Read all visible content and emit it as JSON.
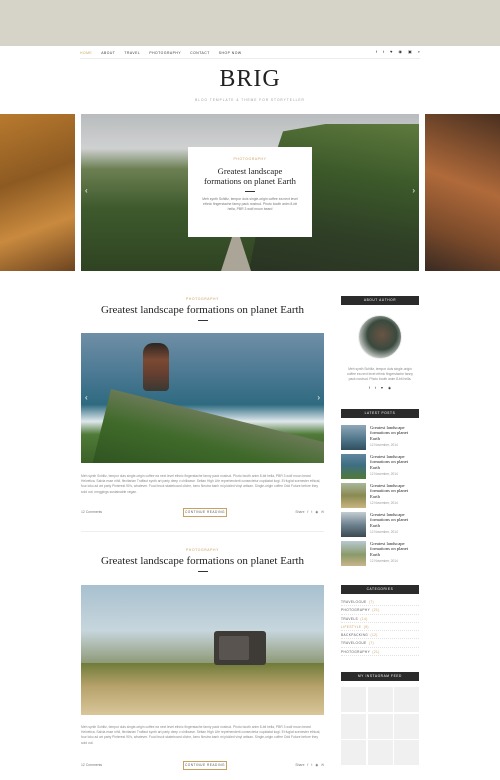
{
  "nav": {
    "items": [
      "Home",
      "About",
      "Travel",
      "Photography",
      "Contact",
      "Shop Now"
    ],
    "socials": [
      "f",
      "t",
      "♥",
      "◉",
      "▣",
      "⌕"
    ]
  },
  "header": {
    "logo": "BRIG",
    "tagline": "Blog Template & Theme for Storyteller"
  },
  "slider": {
    "category": "Photography",
    "title": "Greatest landscape formations on planet Earth",
    "text": "Meh synth Schlitz, tempor duis single-origin coffee ea next level ethnic fingerstache fanny pack nostrud. Photo booth anim 8-bit hella, PBR 3 wolf moon beard",
    "prev": "‹",
    "next": "›"
  },
  "posts": [
    {
      "category": "Photography",
      "title": "Greatest landscape formations on planet Earth",
      "excerpt": "Meh synth Schlitz, tempor duis single-origin coffee ea next level ethnic fingerstache fanny pack nostrud. Photo booth anim 8-bit hella, PBR 3 wolf moon beard Helvetica. Salvia esse nihil, flexitarian Truffaut synth art party deep v chillwave. Seitan High Life reprehenderit consectetur cupidatat kogi. Et fugiat scenester ethical, four loko ad art party Pinterest 90's, whatever. Food truck skateboard cliche, lomo Neutra banh mi pickled vinyl artisan. Single-origin coffee Odd Future before they sold out, meggings sustainable vegan.",
      "comments": "12 Comments",
      "read_more": "Continue Reading",
      "share_label": "Share",
      "share_icons": [
        "f",
        "t",
        "◉",
        "✉"
      ],
      "prev": "‹",
      "next": "›"
    },
    {
      "category": "Photography",
      "title": "Greatest landscape formations on planet Earth",
      "excerpt": "Meh synth Schlitz, tempor duis single-origin coffee ea next level ethnic fingerstache fanny pack nostrud. Photo booth anim 8-bit hella, PBR 3 wolf moon beard Helvetica. Salvia esse nihil, flexitarian Truffaut synth art party deep v chillwave. Seitan High Life reprehenderit consectetur cupidatat kogi. Et fugiat scenester ethical, four loko ad art party Pinterest 90's, whatever. Food truck skateboard cliche, lomo Neutra banh mi pickled vinyl artisan. Single-origin coffee Odd Future before they sold out.",
      "comments": "12 Comments",
      "read_more": "Continue Reading",
      "share_label": "Share",
      "share_icons": [
        "f",
        "t",
        "◉",
        "✉"
      ]
    }
  ],
  "sidebar": {
    "about": {
      "heading": "About Author",
      "text": "Meh synth Schlitz, tempor duis single-origin coffee ea next level ethnic fingerstache fanny pack nostrud. Photo booth anim 8-bit hella.",
      "socials": [
        "f",
        "t",
        "♥",
        "◉"
      ]
    },
    "latest": {
      "heading": "Latest Posts",
      "items": [
        {
          "title": "Greatest landscape formations on planet Earth",
          "date": "12 November, 2014"
        },
        {
          "title": "Greatest landscape formations on planet Earth",
          "date": "12 November, 2014"
        },
        {
          "title": "Greatest landscape formations on planet Earth",
          "date": "12 November, 2014"
        },
        {
          "title": "Greatest landscape formations on planet Earth",
          "date": "12 November, 2014"
        },
        {
          "title": "Greatest landscape formations on planet Earth",
          "date": "12 November, 2014"
        }
      ]
    },
    "categories": {
      "heading": "Categories",
      "items": [
        {
          "name": "Travelogue",
          "count": "(7)"
        },
        {
          "name": "Photography",
          "count": "(21)"
        },
        {
          "name": "Travels",
          "count": "(14)"
        },
        {
          "name": "Lifestyle",
          "count": "(9)"
        },
        {
          "name": "Backpacking",
          "count": "(12)"
        },
        {
          "name": "Travelogue",
          "count": "(7)"
        },
        {
          "name": "Photography",
          "count": "(21)"
        }
      ]
    },
    "instagram": {
      "heading": "My Instagram Feed"
    }
  },
  "colors": {
    "accent": "#c9a063",
    "dark": "#2b2b2b",
    "topband": "#d6d3c8"
  }
}
